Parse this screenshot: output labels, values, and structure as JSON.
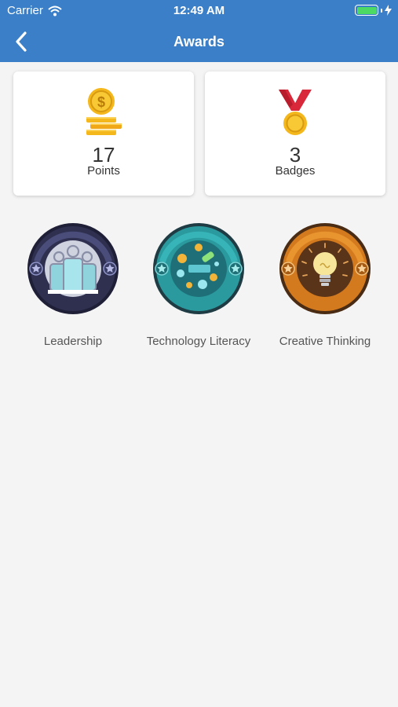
{
  "status_bar": {
    "carrier": "Carrier",
    "time": "12:49 AM",
    "icons": [
      "wifi-icon",
      "battery-icon",
      "charging-bolt-icon"
    ]
  },
  "nav": {
    "title": "Awards",
    "back_icon": "chevron-left-icon"
  },
  "stats": [
    {
      "value": "17",
      "label": "Points",
      "icon": "coin-stack-icon"
    },
    {
      "value": "3",
      "label": "Badges",
      "icon": "medal-icon"
    }
  ],
  "badges": [
    {
      "name": "Leadership",
      "icon": "leadership-badge-icon"
    },
    {
      "name": "Technology Literacy",
      "icon": "technology-badge-icon"
    },
    {
      "name": "Creative Thinking",
      "icon": "lightbulb-badge-icon"
    }
  ],
  "colors": {
    "header": "#3a7fc8",
    "background": "#f4f4f4",
    "leadership": "#2f3050",
    "technology": "#2a9a9e",
    "creative": "#d47a1e"
  }
}
